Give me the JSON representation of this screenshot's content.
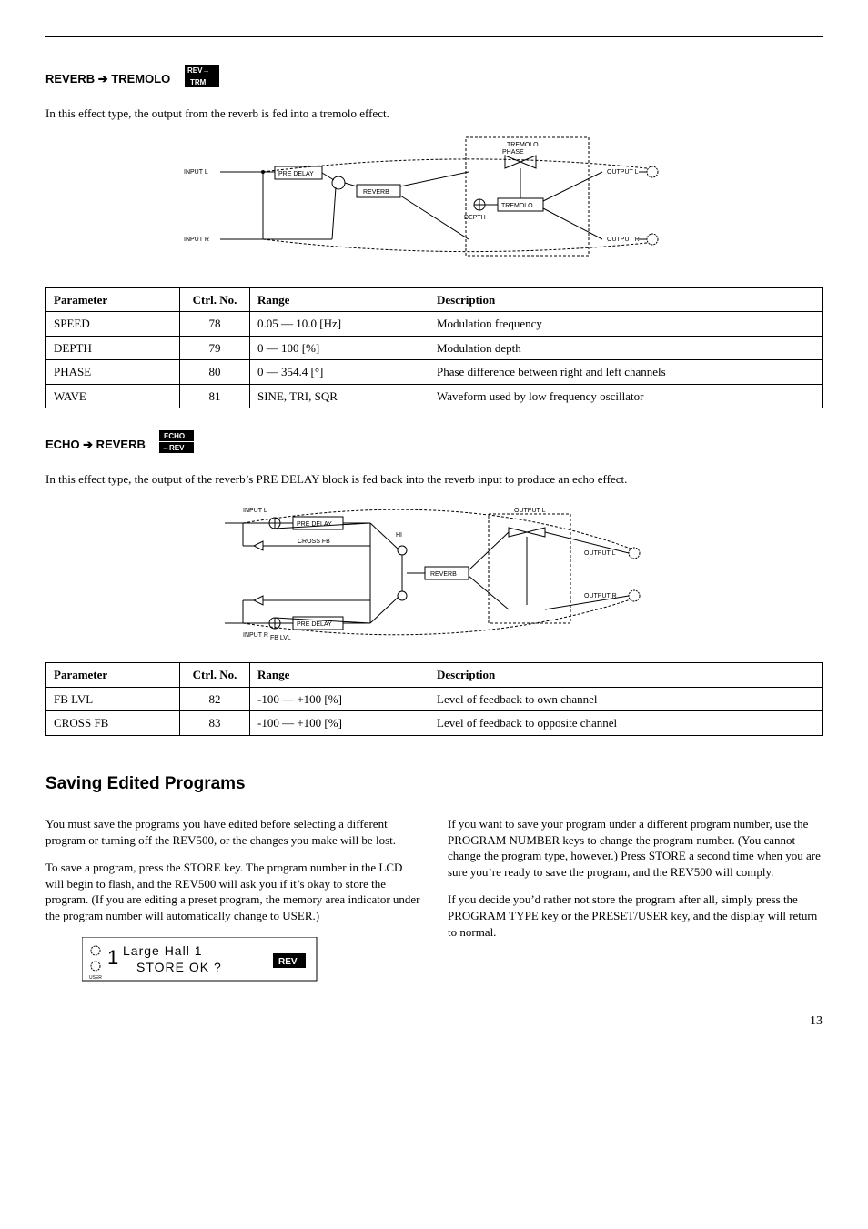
{
  "section1": {
    "title": "REVERB ➔ TREMOLO",
    "iconTop": "REV→",
    "iconBot": "TRM",
    "intro": "In this effect type, the output from the reverb is fed into a tremolo effect.",
    "diagram": {
      "inputL": "INPUT L",
      "inputR": "INPUT R",
      "preDelay": "PRE DELAY",
      "reverb": "REVERB",
      "phase": "PHASE",
      "tremolo": "TREMOLO",
      "depth": "DEPTH",
      "outputL": "OUTPUT L",
      "outputR": "OUTPUT R"
    },
    "headers": {
      "param": "Parameter",
      "ctrl": "Ctrl. No.",
      "range": "Range",
      "desc": "Description"
    },
    "rows": [
      {
        "param": "SPEED",
        "ctrl": "78",
        "range": "0.05 — 10.0 [Hz]",
        "desc": "Modulation frequency"
      },
      {
        "param": "DEPTH",
        "ctrl": "79",
        "range": "0 — 100 [%]",
        "desc": "Modulation depth"
      },
      {
        "param": "PHASE",
        "ctrl": "80",
        "range": "0 — 354.4 [°]",
        "desc": "Phase difference between right and left channels"
      },
      {
        "param": "WAVE",
        "ctrl": "81",
        "range": "SINE, TRI, SQR",
        "desc": "Waveform used by low frequency oscillator"
      }
    ]
  },
  "section2": {
    "title": "ECHO ➔ REVERB",
    "iconTop": "ECHO",
    "iconBot": "→REV",
    "intro": "In this effect type, the output of the reverb’s PRE DELAY block is fed back into the reverb input to produce an echo effect.",
    "diagram": {
      "inputL": "INPUT L",
      "inputR": "INPUT R",
      "preDelay": "PRE DELAY",
      "reverb": "REVERB",
      "crossFb": "CROSS FB",
      "fbLvl": "FB LVL",
      "outputL": "OUTPUT L",
      "outputR": "OUTPUT R"
    },
    "headers": {
      "param": "Parameter",
      "ctrl": "Ctrl. No.",
      "range": "Range",
      "desc": "Description"
    },
    "rows": [
      {
        "param": "FB LVL",
        "ctrl": "82",
        "range": "-100 — +100 [%]",
        "desc": "Level of feedback to own channel"
      },
      {
        "param": "CROSS FB",
        "ctrl": "83",
        "range": "-100 — +100 [%]",
        "desc": "Level of feedback to opposite channel"
      }
    ]
  },
  "saving": {
    "heading": "Saving Edited Programs",
    "col1p1": "You must save the programs you have edited before selecting a different program or turning off the REV500, or the changes you make will be lost.",
    "col1p2": "To save a program, press the STORE key. The program number in the LCD will begin to flash, and the REV500 will ask you if it’s okay to store the program. (If you are editing a preset program, the memory area indicator under the program number will automatically change to USER.)",
    "col2p1": "If you want to save your program under a different program number, use the PROGRAM NUMBER keys to change the program number. (You cannot change the program type, however.) Press STORE a second time when you are sure you’re ready to save the program, and the REV500 will comply.",
    "col2p2": "If you decide you’d rather not store the program after all, simply press the PROGRAM TYPE key or the PRESET/USER key, and the display will return to normal.",
    "lcd": {
      "line1": "Large Hall 1",
      "line2": "STORE OK ?",
      "icon": "REV",
      "num": "1",
      "user": "USER"
    }
  },
  "pageNumber": "13"
}
